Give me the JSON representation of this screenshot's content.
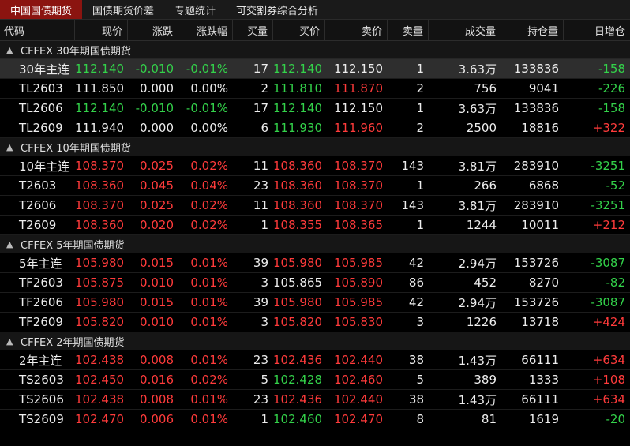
{
  "tabs": [
    "中国国债期货",
    "国债期货价差",
    "专题统计",
    "可交割券综合分析"
  ],
  "active_tab": 0,
  "columns": [
    "代码",
    "现价",
    "涨跌",
    "涨跌幅",
    "买量",
    "买价",
    "卖价",
    "卖量",
    "成交量",
    "持仓量",
    "日增仓"
  ],
  "colors": {
    "up": "#ff3b3b",
    "down": "#33d24a",
    "neutral": "#ededed",
    "active_tab": "#8b1410"
  },
  "groups": [
    {
      "title": "CFFEX 30年期国债期货",
      "rows": [
        {
          "code": "30年主连",
          "price": "112.140",
          "change": "-0.010",
          "pct": "-0.01%",
          "bid_vol": "17",
          "bid": "112.140",
          "ask": "112.150",
          "ask_vol": "1",
          "volume": "3.63万",
          "oi": "133836",
          "oi_chg": "-158",
          "selected": true,
          "c": {
            "price": "green",
            "change": "green",
            "pct": "green",
            "bid": "green",
            "ask": "white",
            "oi_chg": "green"
          }
        },
        {
          "code": "TL2603",
          "price": "111.850",
          "change": "0.000",
          "pct": "0.00%",
          "bid_vol": "2",
          "bid": "111.810",
          "ask": "111.870",
          "ask_vol": "2",
          "volume": "756",
          "oi": "9041",
          "oi_chg": "-226",
          "c": {
            "price": "white",
            "change": "white",
            "pct": "white",
            "bid": "green",
            "ask": "red",
            "oi_chg": "green"
          }
        },
        {
          "code": "TL2606",
          "price": "112.140",
          "change": "-0.010",
          "pct": "-0.01%",
          "bid_vol": "17",
          "bid": "112.140",
          "ask": "112.150",
          "ask_vol": "1",
          "volume": "3.63万",
          "oi": "133836",
          "oi_chg": "-158",
          "c": {
            "price": "green",
            "change": "green",
            "pct": "green",
            "bid": "green",
            "ask": "white",
            "oi_chg": "green"
          }
        },
        {
          "code": "TL2609",
          "price": "111.940",
          "change": "0.000",
          "pct": "0.00%",
          "bid_vol": "6",
          "bid": "111.930",
          "ask": "111.960",
          "ask_vol": "2",
          "volume": "2500",
          "oi": "18816",
          "oi_chg": "+322",
          "c": {
            "price": "white",
            "change": "white",
            "pct": "white",
            "bid": "green",
            "ask": "red",
            "oi_chg": "red"
          }
        }
      ]
    },
    {
      "title": "CFFEX 10年期国债期货",
      "rows": [
        {
          "code": "10年主连",
          "price": "108.370",
          "change": "0.025",
          "pct": "0.02%",
          "bid_vol": "11",
          "bid": "108.360",
          "ask": "108.370",
          "ask_vol": "143",
          "volume": "3.81万",
          "oi": "283910",
          "oi_chg": "-3251",
          "c": {
            "price": "red",
            "change": "red",
            "pct": "red",
            "bid": "red",
            "ask": "red",
            "oi_chg": "green"
          }
        },
        {
          "code": "T2603",
          "price": "108.360",
          "change": "0.045",
          "pct": "0.04%",
          "bid_vol": "23",
          "bid": "108.360",
          "ask": "108.370",
          "ask_vol": "1",
          "volume": "266",
          "oi": "6868",
          "oi_chg": "-52",
          "c": {
            "price": "red",
            "change": "red",
            "pct": "red",
            "bid": "red",
            "ask": "red",
            "oi_chg": "green"
          }
        },
        {
          "code": "T2606",
          "price": "108.370",
          "change": "0.025",
          "pct": "0.02%",
          "bid_vol": "11",
          "bid": "108.360",
          "ask": "108.370",
          "ask_vol": "143",
          "volume": "3.81万",
          "oi": "283910",
          "oi_chg": "-3251",
          "c": {
            "price": "red",
            "change": "red",
            "pct": "red",
            "bid": "red",
            "ask": "red",
            "oi_chg": "green"
          }
        },
        {
          "code": "T2609",
          "price": "108.360",
          "change": "0.020",
          "pct": "0.02%",
          "bid_vol": "1",
          "bid": "108.355",
          "ask": "108.365",
          "ask_vol": "1",
          "volume": "1244",
          "oi": "10011",
          "oi_chg": "+212",
          "c": {
            "price": "red",
            "change": "red",
            "pct": "red",
            "bid": "red",
            "ask": "red",
            "oi_chg": "red"
          }
        }
      ]
    },
    {
      "title": "CFFEX 5年期国债期货",
      "rows": [
        {
          "code": "5年主连",
          "price": "105.980",
          "change": "0.015",
          "pct": "0.01%",
          "bid_vol": "39",
          "bid": "105.980",
          "ask": "105.985",
          "ask_vol": "42",
          "volume": "2.94万",
          "oi": "153726",
          "oi_chg": "-3087",
          "c": {
            "price": "red",
            "change": "red",
            "pct": "red",
            "bid": "red",
            "ask": "red",
            "oi_chg": "green"
          }
        },
        {
          "code": "TF2603",
          "price": "105.875",
          "change": "0.010",
          "pct": "0.01%",
          "bid_vol": "3",
          "bid": "105.865",
          "ask": "105.890",
          "ask_vol": "86",
          "volume": "452",
          "oi": "8270",
          "oi_chg": "-82",
          "c": {
            "price": "red",
            "change": "red",
            "pct": "red",
            "bid": "white",
            "ask": "red",
            "oi_chg": "green"
          }
        },
        {
          "code": "TF2606",
          "price": "105.980",
          "change": "0.015",
          "pct": "0.01%",
          "bid_vol": "39",
          "bid": "105.980",
          "ask": "105.985",
          "ask_vol": "42",
          "volume": "2.94万",
          "oi": "153726",
          "oi_chg": "-3087",
          "c": {
            "price": "red",
            "change": "red",
            "pct": "red",
            "bid": "red",
            "ask": "red",
            "oi_chg": "green"
          }
        },
        {
          "code": "TF2609",
          "price": "105.820",
          "change": "0.010",
          "pct": "0.01%",
          "bid_vol": "3",
          "bid": "105.820",
          "ask": "105.830",
          "ask_vol": "3",
          "volume": "1226",
          "oi": "13718",
          "oi_chg": "+424",
          "c": {
            "price": "red",
            "change": "red",
            "pct": "red",
            "bid": "red",
            "ask": "red",
            "oi_chg": "red"
          }
        }
      ]
    },
    {
      "title": "CFFEX 2年期国债期货",
      "rows": [
        {
          "code": "2年主连",
          "price": "102.438",
          "change": "0.008",
          "pct": "0.01%",
          "bid_vol": "23",
          "bid": "102.436",
          "ask": "102.440",
          "ask_vol": "38",
          "volume": "1.43万",
          "oi": "66111",
          "oi_chg": "+634",
          "c": {
            "price": "red",
            "change": "red",
            "pct": "red",
            "bid": "red",
            "ask": "red",
            "oi_chg": "red"
          }
        },
        {
          "code": "TS2603",
          "price": "102.450",
          "change": "0.016",
          "pct": "0.02%",
          "bid_vol": "5",
          "bid": "102.428",
          "ask": "102.460",
          "ask_vol": "5",
          "volume": "389",
          "oi": "1333",
          "oi_chg": "+108",
          "c": {
            "price": "red",
            "change": "red",
            "pct": "red",
            "bid": "green",
            "ask": "red",
            "oi_chg": "red"
          }
        },
        {
          "code": "TS2606",
          "price": "102.438",
          "change": "0.008",
          "pct": "0.01%",
          "bid_vol": "23",
          "bid": "102.436",
          "ask": "102.440",
          "ask_vol": "38",
          "volume": "1.43万",
          "oi": "66111",
          "oi_chg": "+634",
          "c": {
            "price": "red",
            "change": "red",
            "pct": "red",
            "bid": "red",
            "ask": "red",
            "oi_chg": "red"
          }
        },
        {
          "code": "TS2609",
          "price": "102.470",
          "change": "0.006",
          "pct": "0.01%",
          "bid_vol": "1",
          "bid": "102.460",
          "ask": "102.470",
          "ask_vol": "8",
          "volume": "81",
          "oi": "1619",
          "oi_chg": "-20",
          "c": {
            "price": "red",
            "change": "red",
            "pct": "red",
            "bid": "green",
            "ask": "red",
            "oi_chg": "green"
          }
        }
      ]
    }
  ]
}
